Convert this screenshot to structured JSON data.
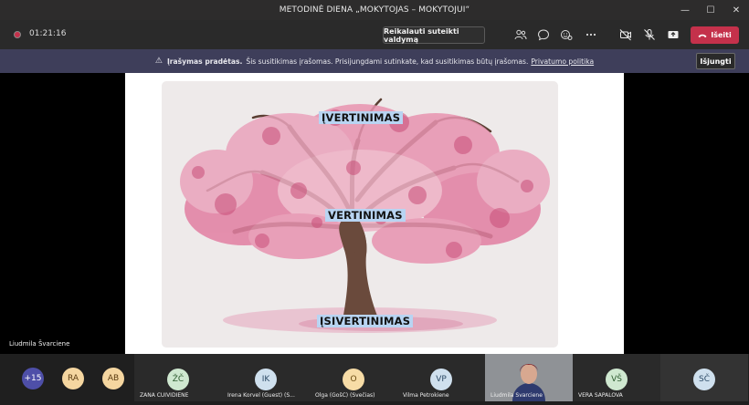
{
  "window": {
    "title": "METODINĖ DIENA „MOKYTOJAS – MOKYTOJUI“"
  },
  "toolbar": {
    "timer": "01:21:16",
    "request_control": "Reikalauti suteikti valdymą",
    "leave": "Išeiti"
  },
  "banner": {
    "title": "Įrašymas pradėtas.",
    "message": "Šis susitikimas įrašomas. Prisijungdami sutinkate, kad susitikimas būtų įrašomas.",
    "link": "Privatumo politika",
    "dismiss": "Išjungti"
  },
  "slide": {
    "label_top": "ĮVERTINIMAS",
    "label_middle": "VERTINIMAS",
    "label_bottom": "ĮSIVERTINIMAS"
  },
  "presenter": {
    "name": "Liudmila Švarciene"
  },
  "participants": {
    "overflow": "+15",
    "small": [
      {
        "initials": "RA",
        "color": "#f5d6a0",
        "text_color": "#5a3a10"
      },
      {
        "initials": "AB",
        "color": "#f5d6a0",
        "text_color": "#5a3a10"
      }
    ],
    "tiles": [
      {
        "initials": "ŽČ",
        "name": "ŽANA ČUIVIDIENE",
        "color": "#cfe8d0",
        "text_color": "#2c5a2e"
      },
      {
        "initials": "IK",
        "name": "Irena Korvel (Guest) (S...",
        "color": "#cfe0ee",
        "text_color": "#2c4a66"
      },
      {
        "initials": "O",
        "name": "Olga (GošĆ) (Svečias)",
        "color": "#f7dca6",
        "text_color": "#6a4a10"
      },
      {
        "initials": "VP",
        "name": "Vilma Petrokiene",
        "color": "#cfe0ee",
        "text_color": "#2c4a66"
      },
      {
        "initials": "",
        "name": "Liudmila Švarciene",
        "color": "#6b6e74",
        "text_color": "#fff"
      },
      {
        "initials": "VŠ",
        "name": "VERA ŠAPALOVA",
        "color": "#cfe8d0",
        "text_color": "#2c5a2e"
      },
      {
        "initials": "SČ",
        "name": "",
        "color": "#cfe0ee",
        "text_color": "#2c4a66"
      }
    ]
  },
  "colors": {
    "leave": "#c4314b",
    "banner": "#3e3e5a",
    "overflow_badge": "#4e4fa8"
  }
}
